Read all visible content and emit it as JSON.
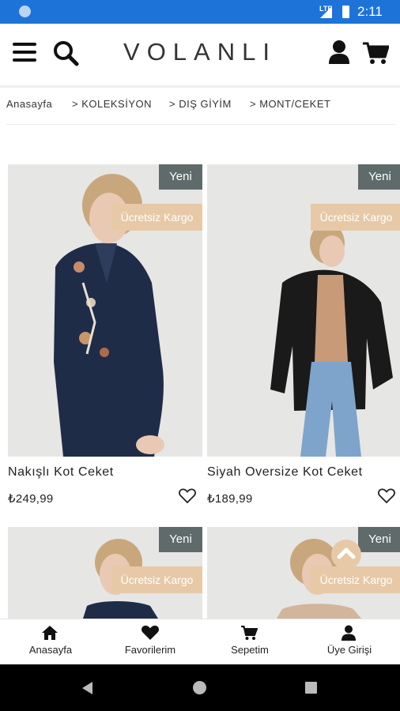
{
  "status_bar": {
    "network": "LTE",
    "time": "2:11"
  },
  "header": {
    "logo": "VOLANLI"
  },
  "breadcrumb": [
    "Anasayfa",
    "> KOLEKSİYON",
    "> DIŞ GİYİM",
    "> MONT/CEKET"
  ],
  "products": [
    {
      "title": "Nakışlı Kot Ceket",
      "price": "₺249,99",
      "badge_new": "Yeni",
      "badge_shipping": "Ücretsiz Kargo"
    },
    {
      "title": "Siyah Oversize Kot Ceket",
      "price": "₺189,99",
      "badge_new": "Yeni",
      "badge_shipping": "Ücretsiz Kargo"
    },
    {
      "badge_new": "Yeni",
      "badge_shipping": "Ücretsiz Kargo"
    },
    {
      "badge_new": "Yeni",
      "badge_shipping": "Ücretsiz Kargo"
    }
  ],
  "bottom_nav": [
    {
      "label": "Anasayfa",
      "icon": "home-icon"
    },
    {
      "label": "Favorilerim",
      "icon": "heart-icon"
    },
    {
      "label": "Sepetim",
      "icon": "cart-icon"
    },
    {
      "label": "Üye Girişi",
      "icon": "user-icon"
    }
  ],
  "colors": {
    "status_bar": "#1e73d8",
    "badge_new": "#5f6b6a",
    "badge_shipping": "#e7c9a7"
  }
}
